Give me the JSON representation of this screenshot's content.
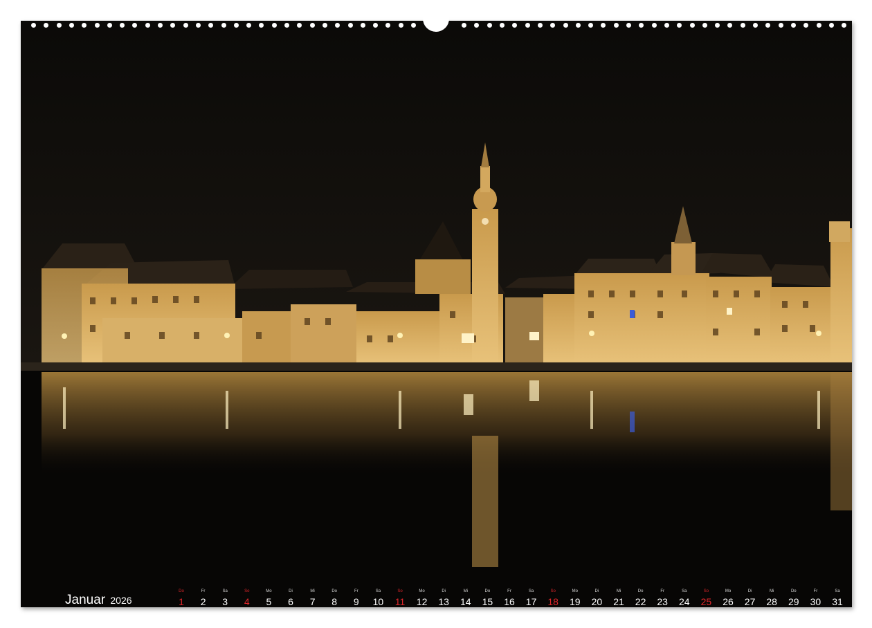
{
  "calendar": {
    "month": "Januar",
    "year": "2026",
    "sunday_color": "#e0262b",
    "days": [
      {
        "wd": "Do",
        "num": "1",
        "sunday": true
      },
      {
        "wd": "Fr",
        "num": "2",
        "sunday": false
      },
      {
        "wd": "Sa",
        "num": "3",
        "sunday": false
      },
      {
        "wd": "So",
        "num": "4",
        "sunday": true
      },
      {
        "wd": "Mo",
        "num": "5",
        "sunday": false
      },
      {
        "wd": "Di",
        "num": "6",
        "sunday": false
      },
      {
        "wd": "Mi",
        "num": "7",
        "sunday": false
      },
      {
        "wd": "Do",
        "num": "8",
        "sunday": false
      },
      {
        "wd": "Fr",
        "num": "9",
        "sunday": false
      },
      {
        "wd": "Sa",
        "num": "10",
        "sunday": false
      },
      {
        "wd": "So",
        "num": "11",
        "sunday": true
      },
      {
        "wd": "Mo",
        "num": "12",
        "sunday": false
      },
      {
        "wd": "Di",
        "num": "13",
        "sunday": false
      },
      {
        "wd": "Mi",
        "num": "14",
        "sunday": false
      },
      {
        "wd": "Do",
        "num": "15",
        "sunday": false
      },
      {
        "wd": "Fr",
        "num": "16",
        "sunday": false
      },
      {
        "wd": "Sa",
        "num": "17",
        "sunday": false
      },
      {
        "wd": "So",
        "num": "18",
        "sunday": true
      },
      {
        "wd": "Mo",
        "num": "19",
        "sunday": false
      },
      {
        "wd": "Di",
        "num": "20",
        "sunday": false
      },
      {
        "wd": "Mi",
        "num": "21",
        "sunday": false
      },
      {
        "wd": "Do",
        "num": "22",
        "sunday": false
      },
      {
        "wd": "Fr",
        "num": "23",
        "sunday": false
      },
      {
        "wd": "Sa",
        "num": "24",
        "sunday": false
      },
      {
        "wd": "So",
        "num": "25",
        "sunday": true
      },
      {
        "wd": "Mo",
        "num": "26",
        "sunday": false
      },
      {
        "wd": "Di",
        "num": "27",
        "sunday": false
      },
      {
        "wd": "Mi",
        "num": "28",
        "sunday": false
      },
      {
        "wd": "Do",
        "num": "29",
        "sunday": false
      },
      {
        "wd": "Fr",
        "num": "30",
        "sunday": false
      },
      {
        "wd": "Sa",
        "num": "31",
        "sunday": false
      }
    ]
  }
}
